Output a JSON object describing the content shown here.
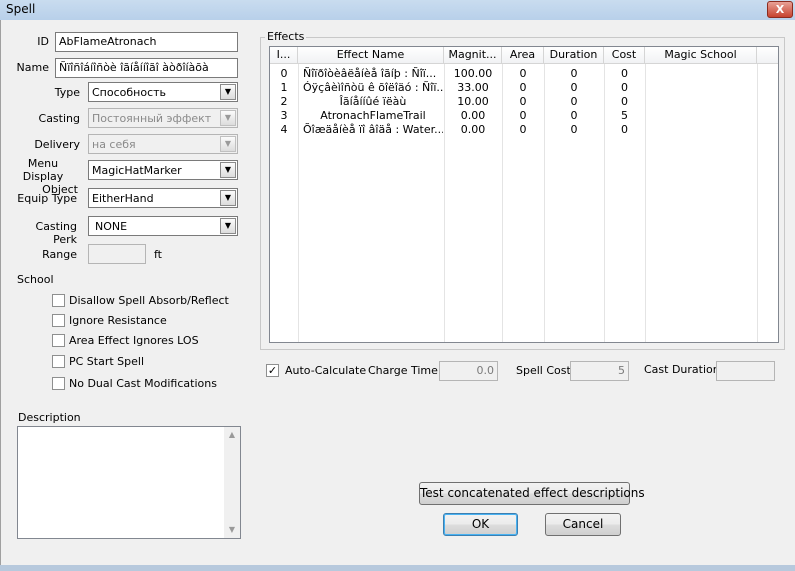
{
  "window": {
    "title": "Spell",
    "close_glyph": "X"
  },
  "form": {
    "id": {
      "label": "ID",
      "value": "AbFlameAtronach"
    },
    "name": {
      "label": "Name",
      "value": "Ñïîñîáíîñòè îãíåííîãî àòðîíàõà"
    },
    "type": {
      "label": "Type",
      "value": "Способность"
    },
    "casting": {
      "label": "Casting",
      "value": "Постоянный эффект"
    },
    "delivery": {
      "label": "Delivery",
      "value": "на себя"
    },
    "menu_display_object": {
      "label_line1": "Menu Display",
      "label_line2": "Object",
      "value": "MagicHatMarker"
    },
    "equip_type": {
      "label": "Equip Type",
      "value": "EitherHand"
    },
    "casting_perk": {
      "label": "Casting Perk",
      "value": "NONE"
    },
    "range": {
      "label": "Range",
      "value": "",
      "unit": "ft"
    }
  },
  "school": {
    "label": "School",
    "checkboxes": [
      {
        "label": "Disallow Spell Absorb/Reflect",
        "checked": false
      },
      {
        "label": "Ignore Resistance",
        "checked": false
      },
      {
        "label": "Area Effect Ignores LOS",
        "checked": false
      },
      {
        "label": "PC Start Spell",
        "checked": false
      },
      {
        "label": "No Dual Cast Modifications",
        "checked": false
      }
    ]
  },
  "description": {
    "label": "Description",
    "value": ""
  },
  "effects": {
    "label": "Effects",
    "columns": [
      "I...",
      "Effect Name",
      "Magnit...",
      "Area",
      "Duration",
      "Cost",
      "Magic School"
    ],
    "rows": [
      {
        "index": "0",
        "name": "Ñîïðîòèâëåíèå îãíþ : Ñîï...",
        "magnitude": "100.00",
        "area": "0",
        "duration": "0",
        "cost": "0",
        "school": ""
      },
      {
        "index": "1",
        "name": "Óÿçâèìîñòü ê õîëîäó : Ñîï...",
        "magnitude": "33.00",
        "area": "0",
        "duration": "0",
        "cost": "0",
        "school": ""
      },
      {
        "index": "2",
        "name": "Îãíåííûé ïëàù",
        "magnitude": "10.00",
        "area": "0",
        "duration": "0",
        "cost": "0",
        "school": ""
      },
      {
        "index": "3",
        "name": "AtronachFlameTrail",
        "magnitude": "0.00",
        "area": "0",
        "duration": "0",
        "cost": "5",
        "school": ""
      },
      {
        "index": "4",
        "name": "Õîæäåíèå ïî âîäå : Water...",
        "magnitude": "0.00",
        "area": "0",
        "duration": "0",
        "cost": "0",
        "school": ""
      }
    ]
  },
  "calc": {
    "auto_calculate": {
      "label": "Auto-Calculate",
      "checked": true,
      "check_glyph": "✓"
    },
    "charge_time": {
      "label": "Charge Time",
      "value": "0.0"
    },
    "spell_cost": {
      "label": "Spell Cost",
      "value": "5"
    },
    "cast_duration": {
      "label": "Cast Duration",
      "value": ""
    }
  },
  "buttons": {
    "test": "Test concatenated effect descriptions",
    "ok": "OK",
    "cancel": "Cancel"
  },
  "icons": {
    "dropdown_arrow": "▼",
    "scroll_up": "▲",
    "scroll_down": "▼"
  }
}
